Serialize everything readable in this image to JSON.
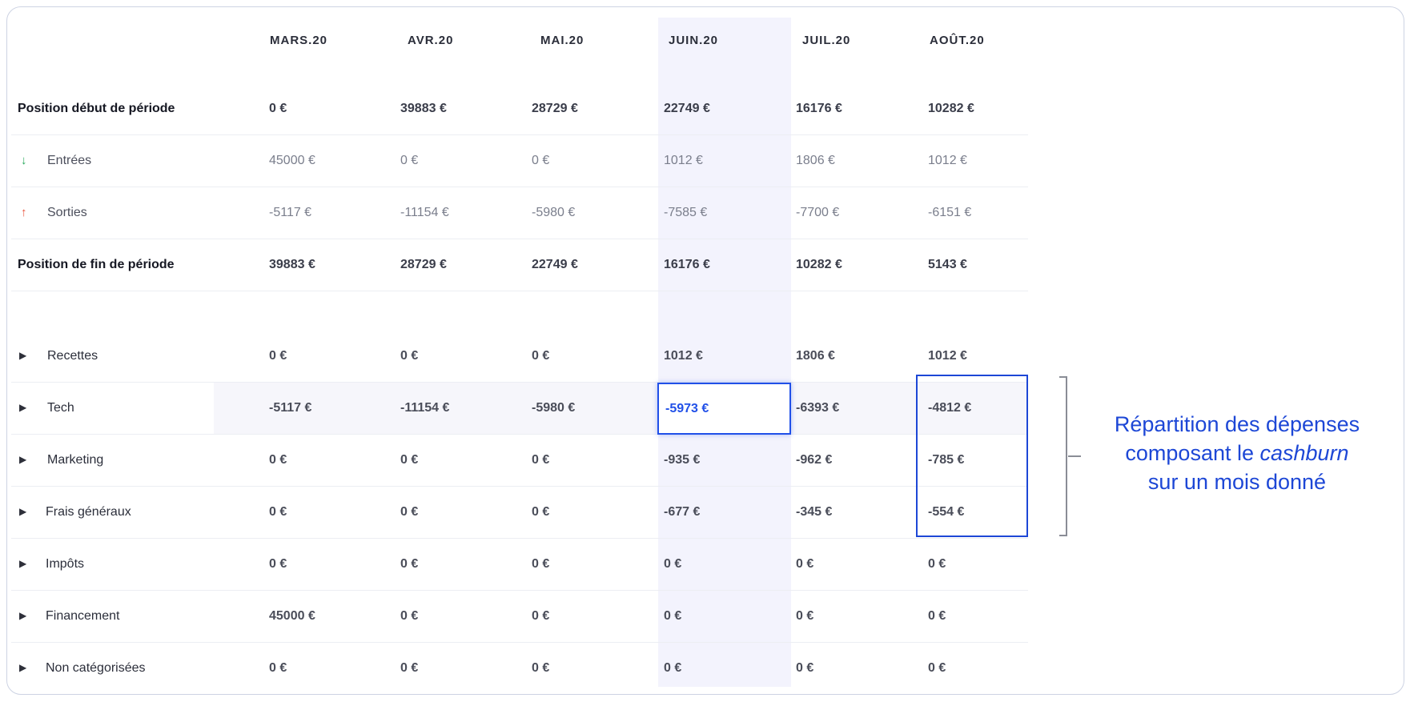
{
  "columns": [
    "MARS.20",
    "AVR.20",
    "MAI.20",
    "JUIN.20",
    "JUIL.20",
    "AOÛT.20"
  ],
  "rows": [
    {
      "label": "Position début de période",
      "values": [
        "0 €",
        "39883 €",
        "28729 €",
        "22749 €",
        "16176 €",
        "10282 €"
      ]
    },
    {
      "label": "Entrées",
      "values": [
        "45000 €",
        "0 €",
        "0 €",
        "1012 €",
        "1806 €",
        "1012 €"
      ]
    },
    {
      "label": "Sorties",
      "values": [
        "-5117 €",
        "-11154 €",
        "-5980 €",
        "-7585 €",
        "-7700 €",
        "-6151 €"
      ]
    },
    {
      "label": "Position de fin de période",
      "values": [
        "39883 €",
        "28729 €",
        "22749 €",
        "16176 €",
        "10282 €",
        "5143 €"
      ]
    }
  ],
  "categories": [
    {
      "label": "Recettes",
      "values": [
        "0 €",
        "0 €",
        "0 €",
        "1012 €",
        "1806 €",
        "1012 €"
      ]
    },
    {
      "label": "Tech",
      "values": [
        "-5117 €",
        "-11154 €",
        "-5980 €",
        "-5973 €",
        "-6393 €",
        "-4812 €"
      ]
    },
    {
      "label": "Marketing",
      "values": [
        "0 €",
        "0 €",
        "0 €",
        "-935 €",
        "-962 €",
        "-785 €"
      ]
    },
    {
      "label": "Frais généraux",
      "values": [
        "0 €",
        "0 €",
        "0 €",
        "-677 €",
        "-345 €",
        "-554 €"
      ]
    },
    {
      "label": "Impôts",
      "values": [
        "0 €",
        "0 €",
        "0 €",
        "0 €",
        "0 €",
        "0 €"
      ]
    },
    {
      "label": "Financement",
      "values": [
        "45000 €",
        "0 €",
        "0 €",
        "0 €",
        "0 €",
        "0 €"
      ]
    },
    {
      "label": "Non catégorisées",
      "values": [
        "0 €",
        "0 €",
        "0 €",
        "0 €",
        "0 €",
        "0 €"
      ]
    }
  ],
  "selected_value": "-5973 €",
  "annotation": {
    "line1": "Répartition des dépenses",
    "line2_prefix": "composant le ",
    "line2_italic": "cashburn",
    "line3": "sur un mois donné"
  },
  "icons": {
    "inflow": "arrow-down-icon",
    "outflow": "arrow-up-icon",
    "expand": "caret-right-icon"
  },
  "colors": {
    "accent": "#2150e8",
    "inflow": "#27a85a",
    "outflow": "#e8523b",
    "highlight_column": "#f3f3fd"
  }
}
